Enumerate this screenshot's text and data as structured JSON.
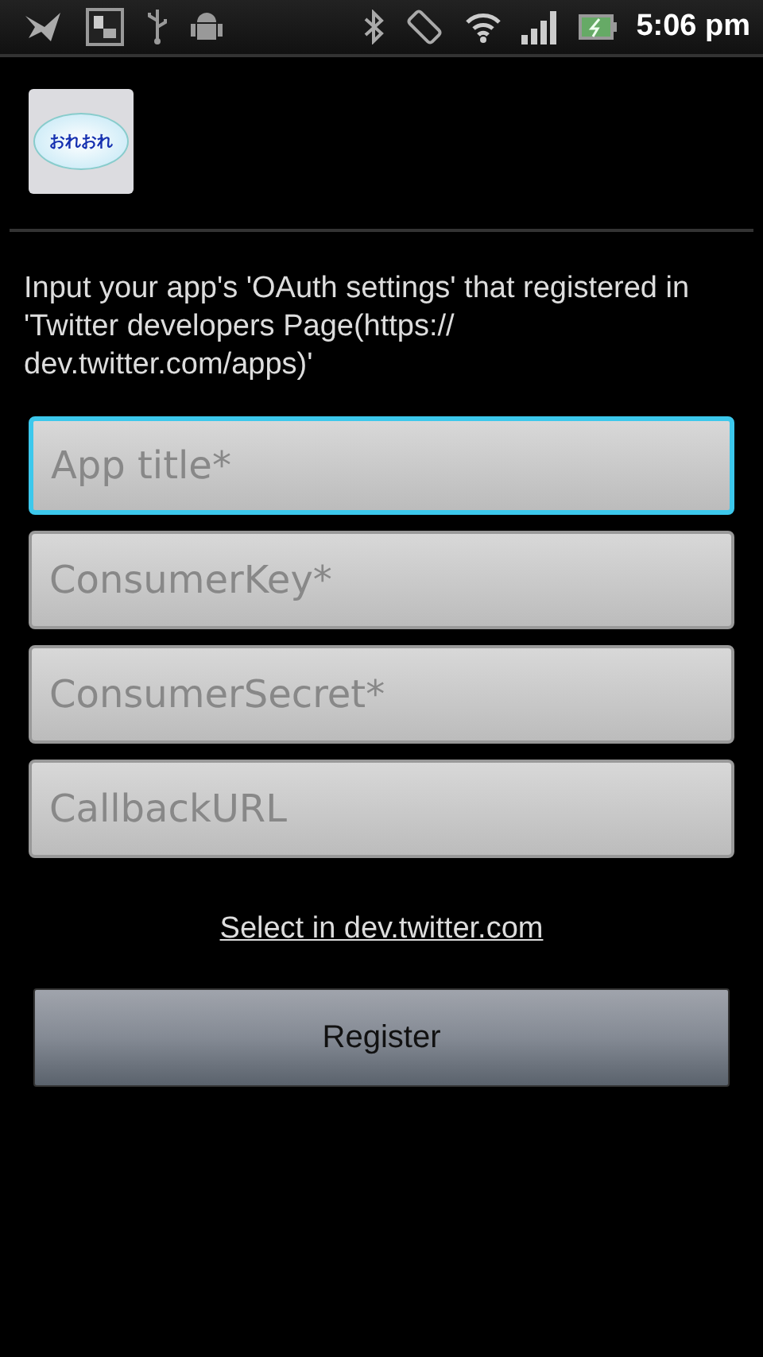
{
  "status_bar": {
    "time": "5:06 pm"
  },
  "app_icon": {
    "label": "おれおれ"
  },
  "instructions": "Input your app's 'OAuth settings' that registered in 'Twitter developers Page(https:// dev.twitter.com/apps)'",
  "fields": [
    {
      "placeholder": "App title*",
      "selected": true
    },
    {
      "placeholder": "ConsumerKey*",
      "selected": false
    },
    {
      "placeholder": "ConsumerSecret*",
      "selected": false
    },
    {
      "placeholder": "CallbackURL",
      "selected": false
    }
  ],
  "link": "Select in dev.twitter.com",
  "buttons": [
    "Register"
  ]
}
